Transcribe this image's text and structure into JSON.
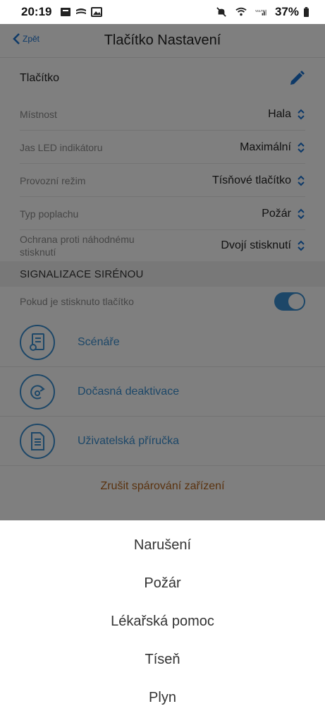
{
  "status_bar": {
    "time": "20:19",
    "battery": "37%"
  },
  "header": {
    "back_label": "Zpět",
    "title": "Tlačítko Nastavení"
  },
  "device_name": "Tlačítko",
  "settings": [
    {
      "label": "Místnost",
      "value": "Hala"
    },
    {
      "label": "Jas LED indikátoru",
      "value": "Maximální"
    },
    {
      "label": "Provozní režim",
      "value": "Tísňové tlačítko"
    },
    {
      "label": "Typ poplachu",
      "value": "Požár"
    },
    {
      "label": "Ochrana proti náhodnému stisknutí",
      "value": "Dvojí stisknutí"
    }
  ],
  "siren_section": {
    "title": "SIGNALIZACE SIRÉNOU",
    "toggle_label": "Pokud je stisknuto tlačítko",
    "toggle_on": true
  },
  "links": [
    {
      "label": "Scénáře",
      "icon": "scenario-document-gear-icon"
    },
    {
      "label": "Dočasná deaktivace",
      "icon": "deactivation-arrow-icon"
    },
    {
      "label": "Uživatelská příručka",
      "icon": "manual-document-icon"
    }
  ],
  "unpair_label": "Zrušit spárování zařízení",
  "alarm_type_options": [
    "Narušení",
    "Požár",
    "Lékařská pomoc",
    "Tíseň",
    "Plyn"
  ],
  "colors": {
    "accent": "#3a8fd0",
    "link_blue": "#1a73d1",
    "unpair": "#b5651d"
  }
}
